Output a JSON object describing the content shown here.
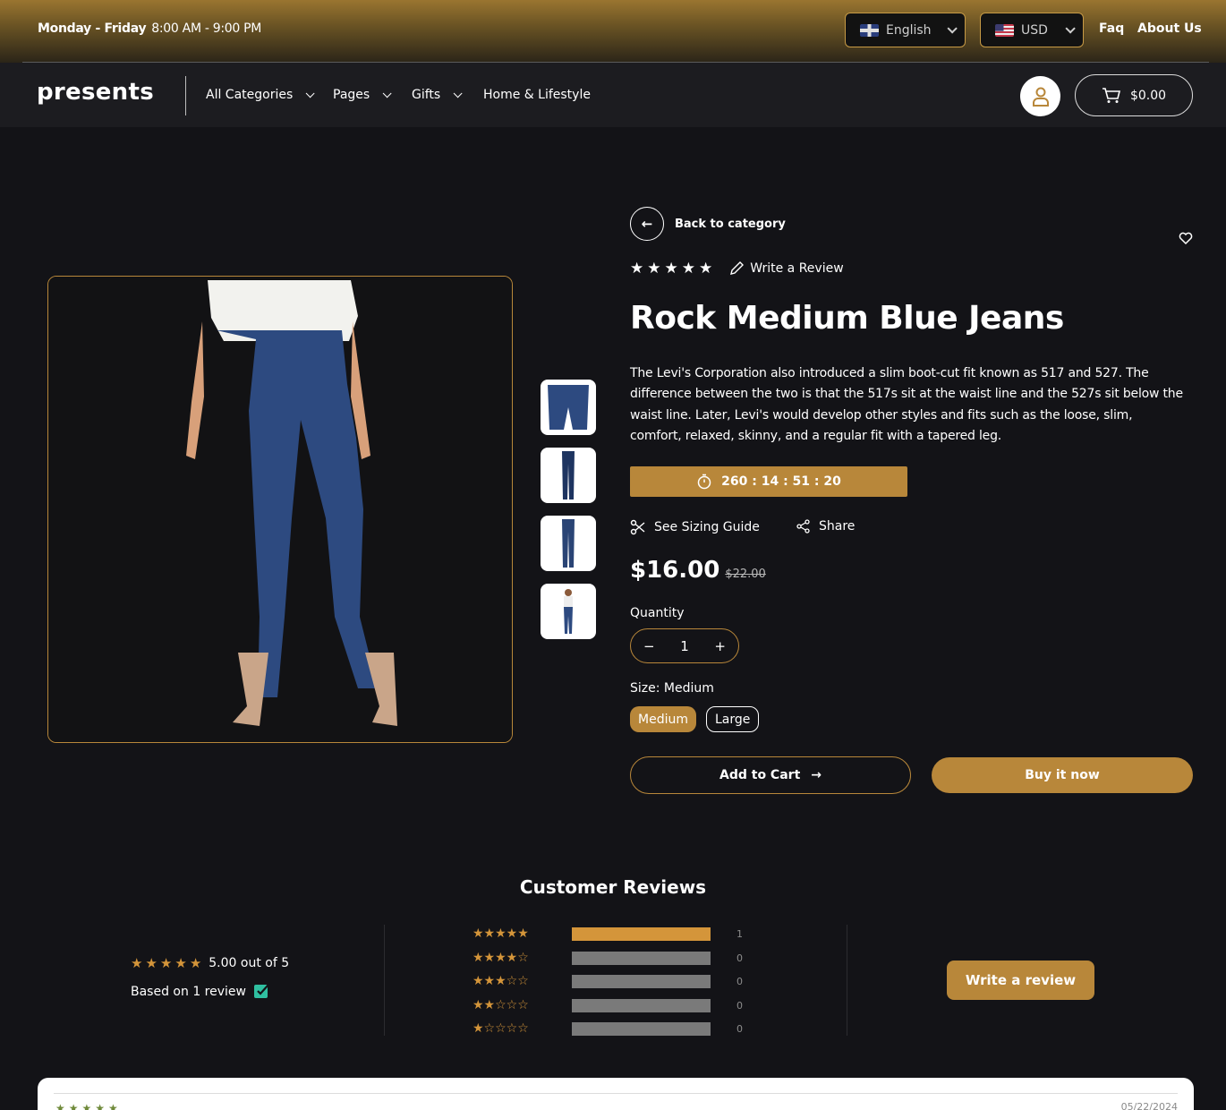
{
  "topbar": {
    "hours_day": "Monday - Friday",
    "hours_time": "8:00 AM - 9:00 PM",
    "language": "English",
    "currency": "USD",
    "faq": "Faq",
    "about": "About Us"
  },
  "nav": {
    "logo": "presents",
    "items": [
      {
        "label": "All Categories"
      },
      {
        "label": "Pages"
      },
      {
        "label": "Gifts"
      },
      {
        "label": "Home & Lifestyle"
      }
    ],
    "cart_total": "$0.00"
  },
  "product": {
    "back_label": "Back to category",
    "write_review_label": "Write a Review",
    "title": "Rock Medium Blue Jeans",
    "description": "The Levi's Corporation also introduced a slim boot-cut fit known as 517 and 527. The difference between the two is that the 517s sit at the waist line and the 527s sit below the waist line. Later, Levi's would develop other styles and fits such as the loose, slim, comfort, relaxed, skinny, and a regular fit with a tapered leg.",
    "countdown": "260 : 14 : 51 : 20",
    "sizing_guide": "See Sizing Guide",
    "share": "Share",
    "price": "$16.00",
    "old_price": "$22.00",
    "quantity_label": "Quantity",
    "quantity": "1",
    "size_label": "Size:",
    "size_value": "Medium",
    "sizes": [
      {
        "label": "Medium"
      },
      {
        "label": "Large"
      }
    ],
    "add_to_cart": "Add to Cart",
    "buy_now": "Buy it now",
    "rating": 5
  },
  "reviews": {
    "title": "Customer Reviews",
    "summary": "5.00 out of 5",
    "based_on": "Based on 1 review",
    "histogram": [
      {
        "stars": 5,
        "count": "1",
        "fraction": 1
      },
      {
        "stars": 4,
        "count": "0",
        "fraction": 0
      },
      {
        "stars": 3,
        "count": "0",
        "fraction": 0
      },
      {
        "stars": 2,
        "count": "0",
        "fraction": 0
      },
      {
        "stars": 1,
        "count": "0",
        "fraction": 0
      }
    ],
    "write_button": "Write a review",
    "first_review_date": "05/22/2024"
  },
  "colors": {
    "accent": "#b8873a",
    "star": "#d4953a",
    "background": "#131317"
  }
}
